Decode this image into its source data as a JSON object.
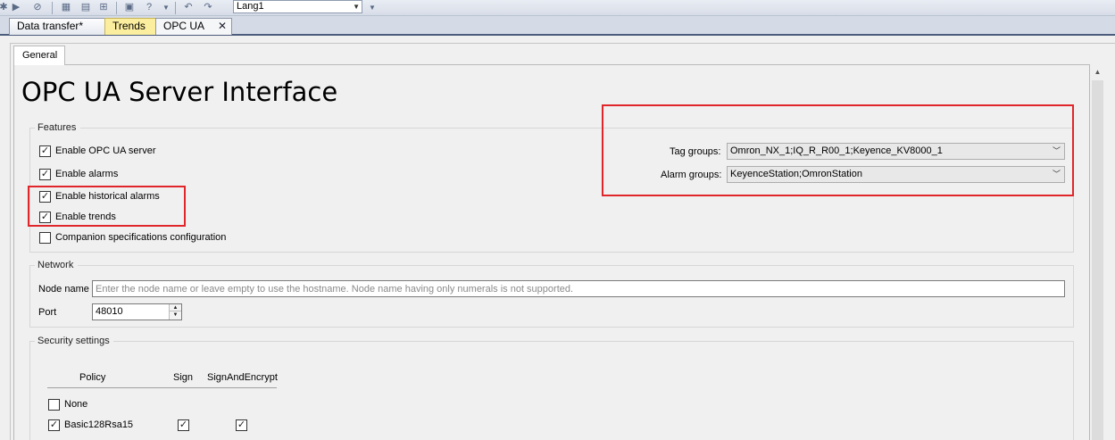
{
  "toolbar": {
    "language": "Lang1"
  },
  "tabs": [
    {
      "label": "Data transfer*"
    },
    {
      "label": "Trends"
    },
    {
      "label": "OPC UA",
      "close": "✕"
    }
  ],
  "subtab": "General",
  "page_title": "OPC UA Server Interface",
  "features": {
    "title": "Features",
    "items": [
      {
        "label": "Enable OPC UA server",
        "checked": true
      },
      {
        "label": "Enable alarms",
        "checked": true
      },
      {
        "label": "Enable historical alarms",
        "checked": true
      },
      {
        "label": "Enable trends",
        "checked": true
      },
      {
        "label": "Companion specifications configuration",
        "checked": false
      }
    ],
    "tag_groups_label": "Tag groups:",
    "tag_groups_value": "Omron_NX_1;IQ_R_R00_1;Keyence_KV8000_1",
    "alarm_groups_label": "Alarm groups:",
    "alarm_groups_value": "KeyenceStation;OmronStation"
  },
  "network": {
    "title": "Network",
    "node_name_label": "Node name",
    "node_name_placeholder": "Enter the node name or leave empty to use the hostname. Node name having only numerals is not supported.",
    "port_label": "Port",
    "port_value": "48010"
  },
  "security": {
    "title": "Security settings",
    "columns": [
      "Policy",
      "Sign",
      "SignAndEncrypt"
    ],
    "rows": [
      {
        "policy": "None",
        "checked": false
      },
      {
        "policy": "Basic128Rsa15",
        "checked": true,
        "sign": true,
        "sign_and_encrypt": true
      }
    ]
  },
  "colors": {
    "highlight": "#e0262a",
    "trends_tab": "#fbee9f"
  }
}
